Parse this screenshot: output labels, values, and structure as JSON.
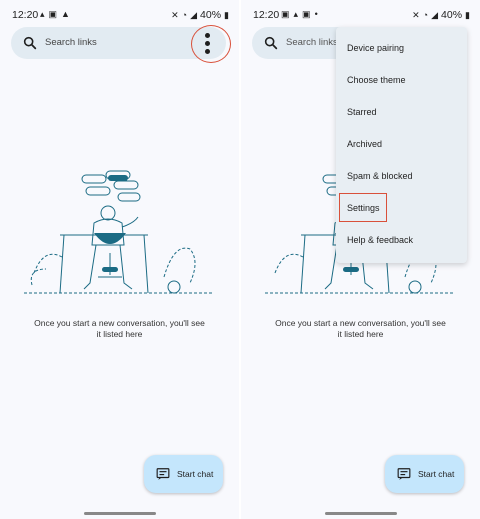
{
  "left_screen": {
    "status": {
      "time": "12:20",
      "battery": "40%"
    },
    "search": {
      "placeholder": "Search links"
    },
    "empty_state": {
      "line1": "Once you start a new conversation, you'll see",
      "line2": "it listed here"
    },
    "fab": {
      "label": "Start chat"
    }
  },
  "right_screen": {
    "status": {
      "time": "12:20",
      "battery": "40%"
    },
    "search": {
      "placeholder": "Search links"
    },
    "empty_state": {
      "line1": "Once you start a new conversation, you'll see",
      "line2": "it listed here"
    },
    "fab": {
      "label": "Start chat"
    },
    "menu": {
      "items": [
        "Device pairing",
        "Choose theme",
        "Starred",
        "Archived",
        "Spam & blocked",
        "Settings",
        "Help & feedback"
      ]
    }
  },
  "colors": {
    "background": "#f8f9fd",
    "search_bar": "#e2ebf2",
    "fab": "#c4e6fc",
    "menu": "#e8eef3",
    "highlight": "#d9503a",
    "illustration_teal": "#1b6b84"
  },
  "icons": [
    "search-icon",
    "more-vert-icon",
    "start-chat-icon",
    "mute-icon",
    "wifi-icon",
    "signal-icon",
    "battery-icon"
  ]
}
